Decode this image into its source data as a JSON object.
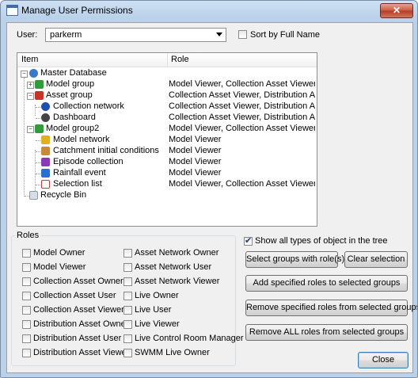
{
  "window": {
    "title": "Manage User Permissions",
    "close_glyph": "✕"
  },
  "user": {
    "label": "User:",
    "value": "parkerm",
    "sort_label": "Sort by Full Name"
  },
  "tree": {
    "headers": {
      "item": "Item",
      "role": "Role"
    },
    "rows": [
      {
        "name": "Master Database",
        "role": "",
        "icon": "database-icon",
        "color": "#3a78c8"
      },
      {
        "name": "Model group",
        "role": "Model Viewer, Collection Asset Viewer, Dist...",
        "icon": "model-group-icon",
        "color": "#2f9b3a"
      },
      {
        "name": "Asset group",
        "role": "Collection Asset Viewer, Distribution Asset ...",
        "icon": "asset-group-icon",
        "color": "#c8342a"
      },
      {
        "name": "Collection network",
        "role": "Collection Asset Viewer, Distribution Asset ...",
        "icon": "collection-network-icon",
        "color": "#1f4fb0"
      },
      {
        "name": "Dashboard",
        "role": "Collection Asset Viewer, Distribution Asset ...",
        "icon": "dashboard-icon",
        "color": "#444444"
      },
      {
        "name": "Model group2",
        "role": "Model Viewer, Collection Asset Viewer, Dist...",
        "icon": "model-group-icon",
        "color": "#2f9b3a"
      },
      {
        "name": "Model network",
        "role": "Model Viewer",
        "icon": "model-network-icon",
        "color": "#e0b020"
      },
      {
        "name": "Catchment initial conditions",
        "role": "Model Viewer",
        "icon": "catchment-icon",
        "color": "#c78a3a"
      },
      {
        "name": "Episode collection",
        "role": "Model Viewer",
        "icon": "episode-collection-icon",
        "color": "#8a3ab8"
      },
      {
        "name": "Rainfall event",
        "role": "Model Viewer",
        "icon": "rainfall-event-icon",
        "color": "#2a6fd0"
      },
      {
        "name": "Selection list",
        "role": "Model Viewer, Collection Asset Viewer, Dist...",
        "icon": "selection-list-icon",
        "color": "#c83a3a"
      },
      {
        "name": "Recycle Bin",
        "role": "",
        "icon": "recycle-bin-icon",
        "color": "#8a9bb0"
      }
    ]
  },
  "roles": {
    "title": "Roles",
    "left": [
      "Model Owner",
      "Model Viewer",
      "Collection Asset Owner",
      "Collection Asset User",
      "Collection Asset Viewer",
      "Distribution Asset Owner",
      "Distribution Asset User",
      "Distribution Asset Viewer"
    ],
    "right": [
      "Asset Network Owner",
      "Asset Network User",
      "Asset Network Viewer",
      "Live Owner",
      "Live User",
      "Live Viewer",
      "Live Control Room Manager",
      "SWMM Live Owner"
    ]
  },
  "options": {
    "show_all_label": "Show all types of object in the tree",
    "show_all_checked": true
  },
  "buttons": {
    "select_groups": "Select groups with role(s)",
    "clear_selection": "Clear selection",
    "add_roles": "Add specified roles to selected groups",
    "remove_roles": "Remove specified roles from selected groups",
    "remove_all": "Remove ALL roles from selected groups",
    "close": "Close"
  }
}
